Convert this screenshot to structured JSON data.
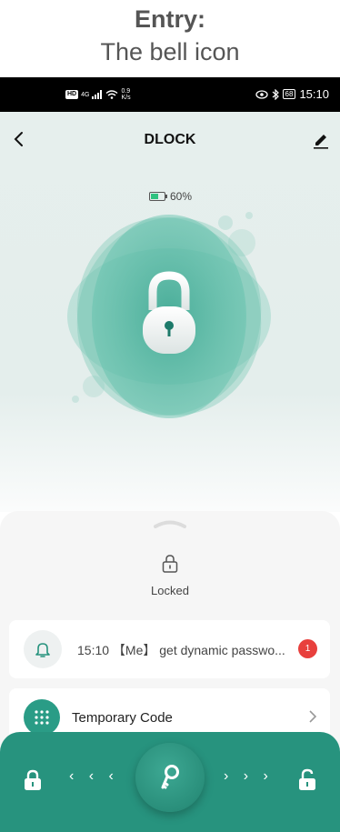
{
  "caption": {
    "line1": "Entry:",
    "line2": "The bell icon"
  },
  "status_bar": {
    "hd": "HD",
    "network": "4G",
    "speed_value": "0.9",
    "speed_unit": "K/s",
    "battery": "68",
    "time": "15:10"
  },
  "header": {
    "title": "DLOCK",
    "back_icon": "chevron-left-icon",
    "edit_icon": "pencil-icon"
  },
  "device": {
    "battery_level": 0.6,
    "battery_label": "60%",
    "lock_icon": "padlock-icon"
  },
  "lock_status": {
    "label": "Locked"
  },
  "message": {
    "text": "15:10 【Me】 get dynamic passwo...",
    "badge": "1",
    "icon": "bell-icon"
  },
  "temporary_code": {
    "label": "Temporary Code",
    "icon": "keypad-icon"
  },
  "slider": {
    "left_arrows": "‹ ‹ ‹",
    "right_arrows": "› › ›",
    "left_icon": "lock-icon",
    "right_icon": "unlock-icon",
    "knob_icon": "key-icon"
  },
  "colors": {
    "accent": "#27937e",
    "badge": "#e8403d",
    "battery": "#2fc280"
  }
}
